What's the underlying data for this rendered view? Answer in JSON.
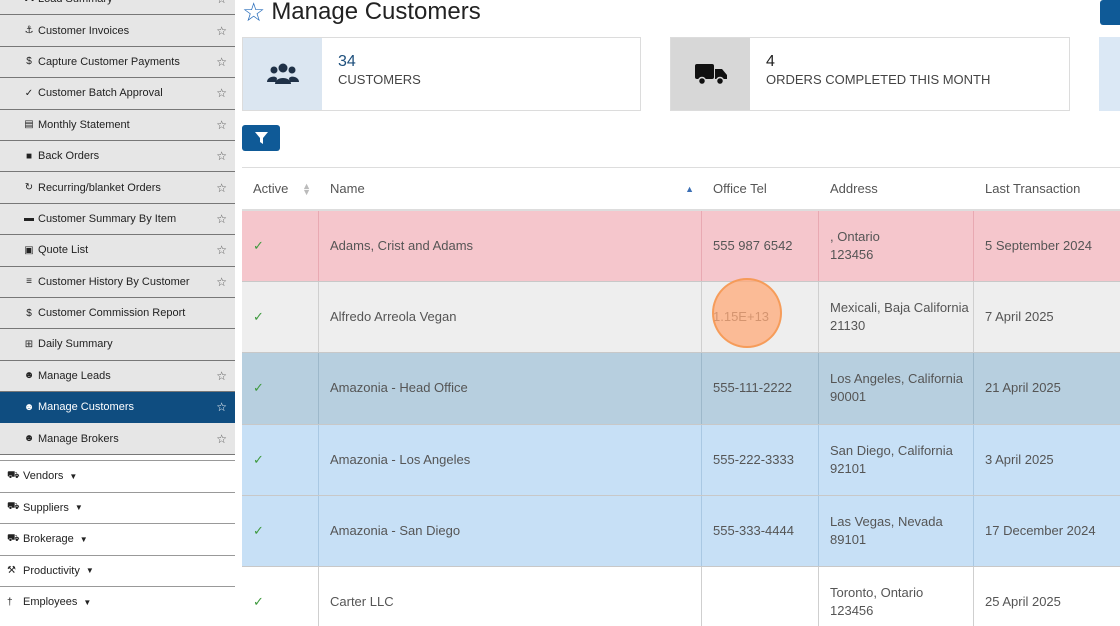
{
  "sidebar": {
    "sub_items": [
      {
        "label": "Load Summary",
        "icon": "⛟",
        "starred": true,
        "active": false
      },
      {
        "label": "Customer Invoices",
        "icon": "⚓",
        "starred": true,
        "active": false
      },
      {
        "label": "Capture Customer Payments",
        "icon": "$",
        "starred": true,
        "active": false
      },
      {
        "label": "Customer Batch Approval",
        "icon": "✓",
        "starred": true,
        "active": false
      },
      {
        "label": "Monthly Statement",
        "icon": "▤",
        "starred": true,
        "active": false
      },
      {
        "label": "Back Orders",
        "icon": "■",
        "starred": true,
        "active": false
      },
      {
        "label": "Recurring/blanket Orders",
        "icon": "↻",
        "starred": true,
        "active": false
      },
      {
        "label": "Customer Summary By Item",
        "icon": "▬",
        "starred": true,
        "active": false
      },
      {
        "label": "Quote List",
        "icon": "▣",
        "starred": true,
        "active": false
      },
      {
        "label": "Customer History By Customer",
        "icon": "≡",
        "starred": true,
        "active": false
      },
      {
        "label": "Customer Commission Report",
        "icon": "$",
        "starred": false,
        "active": false
      },
      {
        "label": "Daily Summary",
        "icon": "⊞",
        "starred": false,
        "active": false
      },
      {
        "label": "Manage Leads",
        "icon": "☻",
        "starred": true,
        "active": false
      },
      {
        "label": "Manage Customers",
        "icon": "☻",
        "starred": true,
        "active": true
      },
      {
        "label": "Manage Brokers",
        "icon": "☻",
        "starred": true,
        "active": false
      }
    ],
    "main_items": [
      {
        "label": "Vendors",
        "icon": "⛟"
      },
      {
        "label": "Suppliers",
        "icon": "⛟"
      },
      {
        "label": "Brokerage",
        "icon": "⛟"
      },
      {
        "label": "Productivity",
        "icon": "⚒"
      },
      {
        "label": "Employees",
        "icon": "†"
      }
    ]
  },
  "page": {
    "title": "Manage Customers",
    "title_icon": "star-outline-icon"
  },
  "stats": [
    {
      "number": "34",
      "label": "CUSTOMERS",
      "icon": "users-icon"
    },
    {
      "number": "4",
      "label": "ORDERS COMPLETED THIS MONTH",
      "icon": "truck-icon"
    }
  ],
  "table": {
    "columns": [
      "Active",
      "Name",
      "Office Tel",
      "Address",
      "Last Transaction"
    ],
    "rows": [
      {
        "active": "✓",
        "name": "Adams, Crist and Adams",
        "tel": "555 987 6542",
        "addr1": ", Ontario",
        "addr2": "123456",
        "last": "5 September 2024",
        "style": "row-pink"
      },
      {
        "active": "✓",
        "name": "Alfredo Arreola Vegan",
        "tel": "1.15E+13",
        "addr1": "Mexicali, Baja California",
        "addr2": "21130",
        "last": "7 April 2025",
        "style": "row-gray"
      },
      {
        "active": "✓",
        "name": "Amazonia - Head Office",
        "tel": "555-111-2222",
        "addr1": "Los Angeles, California",
        "addr2": "90001",
        "last": "21 April 2025",
        "style": "row-steel"
      },
      {
        "active": "✓",
        "name": "Amazonia - Los Angeles",
        "tel": "555-222-3333",
        "addr1": "San Diego, California",
        "addr2": "92101",
        "last": "3 April 2025",
        "style": "row-blue"
      },
      {
        "active": "✓",
        "name": "Amazonia - San Diego",
        "tel": "555-333-4444",
        "addr1": "Las Vegas, Nevada",
        "addr2": "89101",
        "last": "17 December 2024",
        "style": "row-blue"
      },
      {
        "active": "✓",
        "name": "Carter LLC",
        "tel": "",
        "addr1": "Toronto, Ontario",
        "addr2": "123456",
        "last": "25 April 2025",
        "style": "row-white"
      }
    ]
  },
  "colors": {
    "primary": "#0f5a97",
    "active_nav": "#0f4d80",
    "row_pink": "#f5c6cc",
    "row_steel": "#b7cfdf",
    "row_blue": "#c7e0f6"
  }
}
